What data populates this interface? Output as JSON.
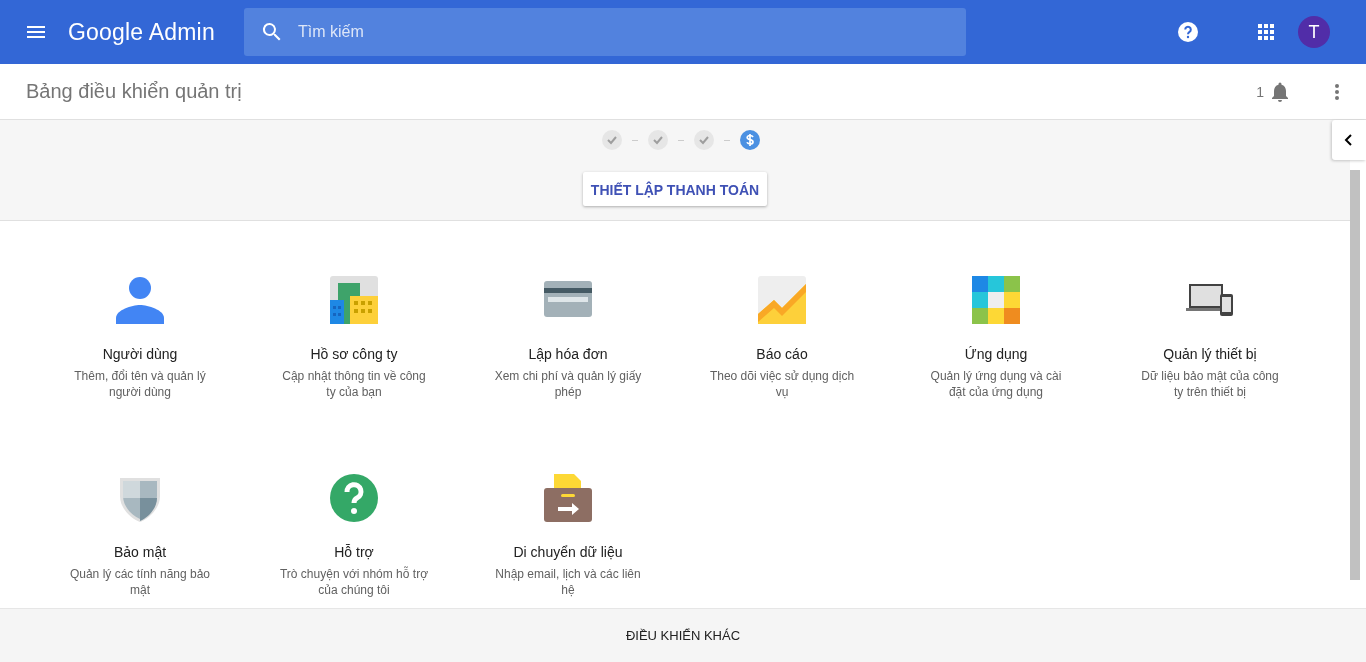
{
  "topbar": {
    "product": "Google Admin",
    "search": {
      "placeholder": "Tìm kiếm"
    },
    "avatar": "T"
  },
  "header": {
    "title": "Bảng điều khiển quản trị",
    "notification_count": "1"
  },
  "setup": {
    "steps": [
      {
        "kind": "done"
      },
      {
        "kind": "done"
      },
      {
        "kind": "done"
      },
      {
        "kind": "current"
      }
    ],
    "button": "THIẾT LẬP THANH TOÁN"
  },
  "cards": [
    {
      "kind": "users",
      "title": "Người dùng",
      "description": "Thêm, đổi tên và quản lý người dùng"
    },
    {
      "kind": "company",
      "title": "Hồ sơ công ty",
      "description": "Cập nhật thông tin về công ty của bạn"
    },
    {
      "kind": "billing",
      "title": "Lập hóa đơn",
      "description": "Xem chi phí và quản lý giấy phép"
    },
    {
      "kind": "reports",
      "title": "Báo cáo",
      "description": "Theo dõi việc sử dụng dịch vụ"
    },
    {
      "kind": "apps",
      "title": "Ứng dụng",
      "description": "Quản lý ứng dụng và cài đặt của ứng dụng"
    },
    {
      "kind": "devices",
      "title": "Quản lý thiết bị",
      "description": "Dữ liệu bảo mật của công ty trên thiết bị"
    },
    {
      "kind": "security",
      "title": "Bảo mật",
      "description": "Quản lý các tính năng bảo mật"
    },
    {
      "kind": "support",
      "title": "Hỗ trợ",
      "description": "Trò chuyện với nhóm hỗ trợ của chúng tôi"
    },
    {
      "kind": "migration",
      "title": "Di chuyển dữ liệu",
      "description": "Nhập email, lịch và các liên hệ"
    }
  ],
  "footer": {
    "button": "ĐIỀU KHIỂN KHÁC"
  }
}
